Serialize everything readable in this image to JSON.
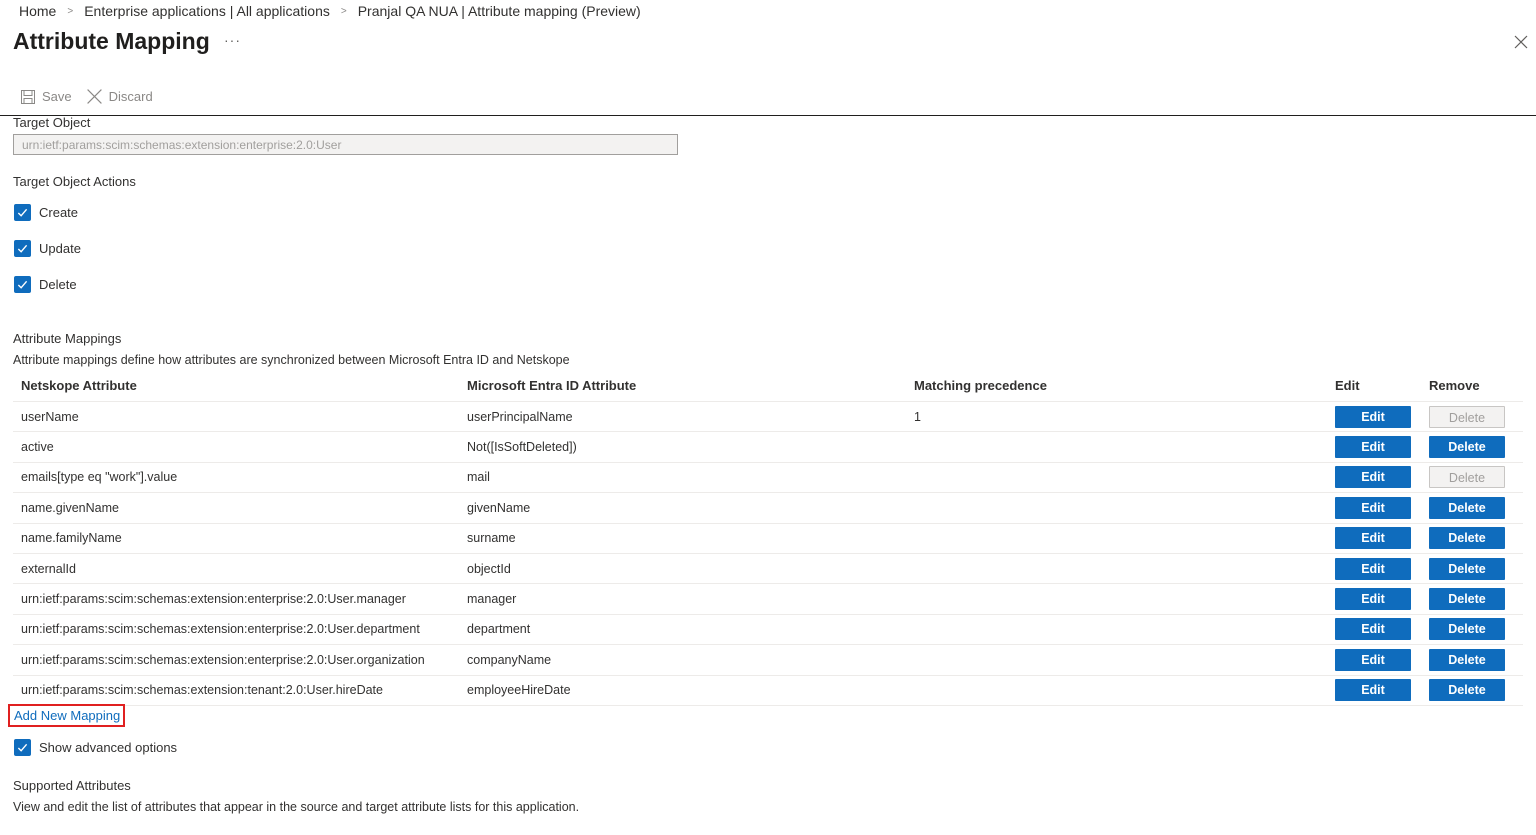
{
  "breadcrumb": [
    "Home",
    "Enterprise applications | All applications",
    "Pranjal QA NUA | Attribute mapping (Preview)"
  ],
  "page": {
    "title": "Attribute Mapping",
    "more": "···"
  },
  "toolbar": {
    "save_label": "Save",
    "discard_label": "Discard"
  },
  "target_object": {
    "label": "Target Object",
    "value": "urn:ietf:params:scim:schemas:extension:enterprise:2.0:User"
  },
  "target_actions": {
    "label": "Target Object Actions",
    "items": [
      {
        "label": "Create",
        "checked": true
      },
      {
        "label": "Update",
        "checked": true
      },
      {
        "label": "Delete",
        "checked": true
      }
    ]
  },
  "mappings": {
    "heading": "Attribute Mappings",
    "description": "Attribute mappings define how attributes are synchronized between Microsoft Entra ID and Netskope",
    "columns": [
      "Netskope Attribute",
      "Microsoft Entra ID Attribute",
      "Matching precedence",
      "Edit",
      "Remove"
    ],
    "edit_label": "Edit",
    "delete_label": "Delete",
    "rows": [
      {
        "target": "userName",
        "source": "userPrincipalName",
        "precedence": "1",
        "delete_enabled": false
      },
      {
        "target": "active",
        "source": "Not([IsSoftDeleted])",
        "precedence": "",
        "delete_enabled": true
      },
      {
        "target": "emails[type eq \"work\"].value",
        "source": "mail",
        "precedence": "",
        "delete_enabled": false
      },
      {
        "target": "name.givenName",
        "source": "givenName",
        "precedence": "",
        "delete_enabled": true
      },
      {
        "target": "name.familyName",
        "source": "surname",
        "precedence": "",
        "delete_enabled": true
      },
      {
        "target": "externalId",
        "source": "objectId",
        "precedence": "",
        "delete_enabled": true
      },
      {
        "target": "urn:ietf:params:scim:schemas:extension:enterprise:2.0:User.manager",
        "source": "manager",
        "precedence": "",
        "delete_enabled": true
      },
      {
        "target": "urn:ietf:params:scim:schemas:extension:enterprise:2.0:User.department",
        "source": "department",
        "precedence": "",
        "delete_enabled": true
      },
      {
        "target": "urn:ietf:params:scim:schemas:extension:enterprise:2.0:User.organization",
        "source": "companyName",
        "precedence": "",
        "delete_enabled": true
      },
      {
        "target": "urn:ietf:params:scim:schemas:extension:tenant:2.0:User.hireDate",
        "source": "employeeHireDate",
        "precedence": "",
        "delete_enabled": true
      }
    ]
  },
  "add_mapping_label": "Add New Mapping",
  "advanced": {
    "label": "Show advanced options",
    "checked": true
  },
  "supported": {
    "heading": "Supported Attributes",
    "description": "View and edit the list of attributes that appear in the source and target attribute lists for this application."
  },
  "colors": {
    "accent": "#0f6cbd",
    "highlight": "#e02020"
  }
}
